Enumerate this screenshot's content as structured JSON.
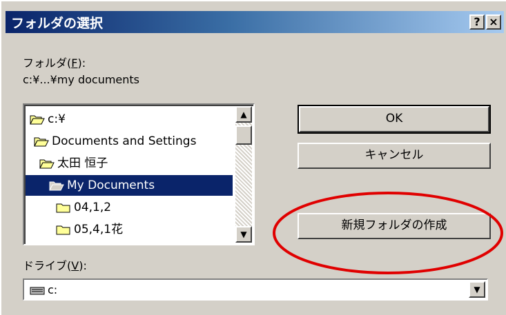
{
  "window": {
    "title": "フォルダの選択",
    "help_label": "?",
    "close_label": "×"
  },
  "folder": {
    "label_prefix": "フォルダ(",
    "label_key": "F",
    "label_suffix": "):",
    "path": "c:¥...¥my documents"
  },
  "tree": {
    "items": [
      {
        "label": "c:¥",
        "icon": "folder-open-icon",
        "level": 0,
        "selected": false
      },
      {
        "label": "Documents and Settings",
        "icon": "folder-open-icon",
        "level": 1,
        "selected": false
      },
      {
        "label": "太田  恒子",
        "icon": "folder-open-icon",
        "level": 2,
        "selected": false
      },
      {
        "label": "My Documents",
        "icon": "folder-open-icon",
        "level": 3,
        "selected": true
      },
      {
        "label": "04,1,2",
        "icon": "folder-closed-icon",
        "level": 4,
        "selected": false
      },
      {
        "label": "05,4,1花",
        "icon": "folder-closed-icon",
        "level": 4,
        "selected": false
      }
    ]
  },
  "buttons": {
    "ok": "OK",
    "cancel": "キャンセル",
    "new_folder": "新規フォルダの作成"
  },
  "drive": {
    "label_prefix": "ドライブ(",
    "label_key": "V",
    "label_suffix": "):",
    "value": "c:",
    "icon": "drive-icon"
  },
  "colors": {
    "title_bar": "#0a246a",
    "selection": "#0a246a",
    "annotation": "#e00000",
    "dialog_bg": "#d4d0c8"
  }
}
